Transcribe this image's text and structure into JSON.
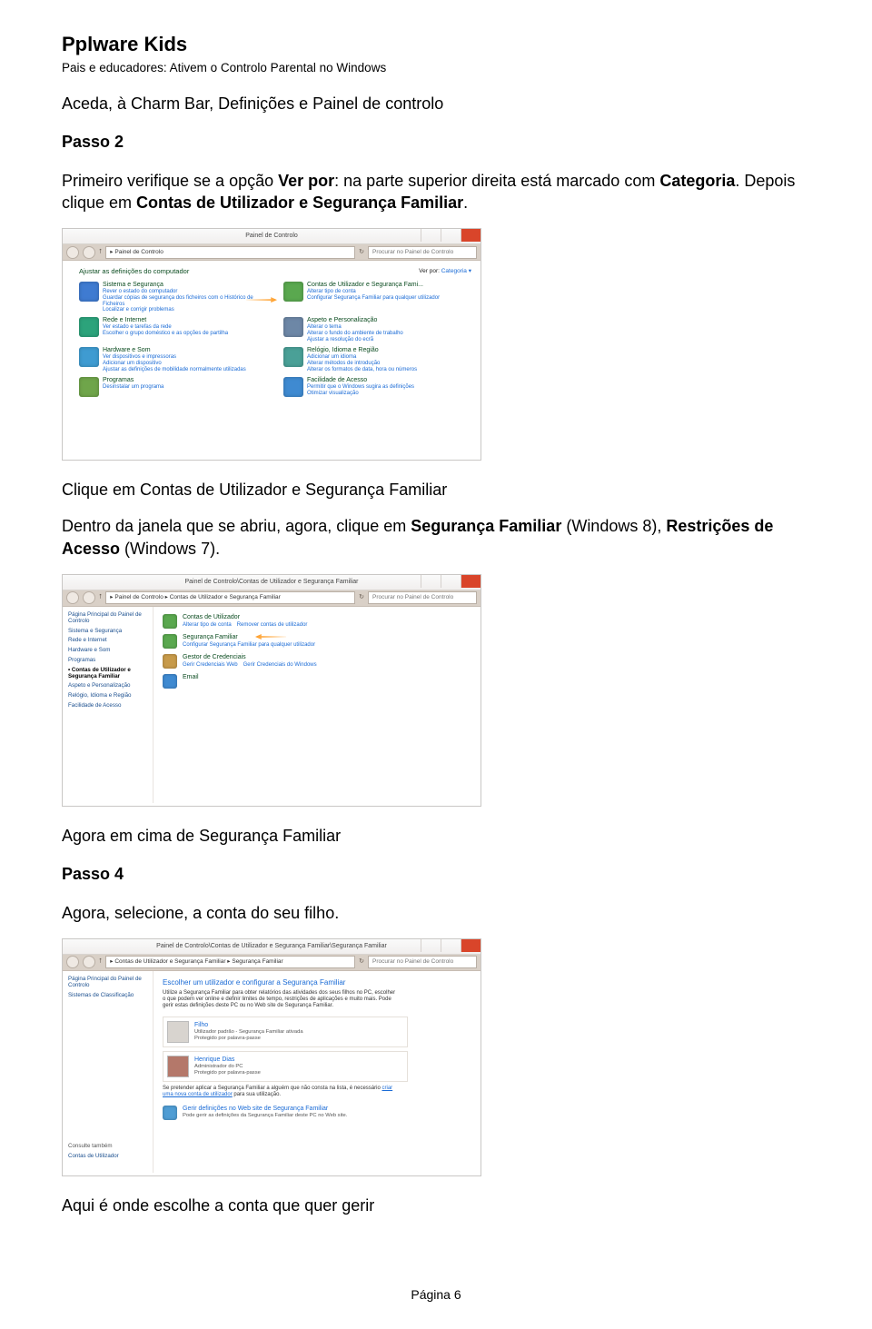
{
  "header": {
    "site_title": "Pplware Kids",
    "subtitle": "Pais e educadores: Ativem o Controlo Parental no Windows"
  },
  "intro_line": "Aceda,  à Charm Bar, Definições e Painel de controlo",
  "passo2": "Passo 2",
  "para2_a": "Primeiro verifique se a opção ",
  "para2_b": "Ver por",
  "para2_c": ": na parte superior direita está marcado com ",
  "para2_d": "Categoria",
  "para2_e": ". Depois clique em ",
  "para2_f": "Contas de Utilizador e Segurança Familiar",
  "para2_g": ".",
  "shot1": {
    "title": "Painel de Controlo",
    "breadcrumb": "▸ Painel de Controlo",
    "search_ph": "Procurar no Painel de Controlo",
    "adjust": "Ajustar as definições do computador",
    "viewby_lbl": "Ver por:",
    "viewby_val": "Categoria ▾",
    "cats_left": [
      {
        "t": "Sistema e Segurança",
        "l": [
          "Rever o estado do computador",
          "Guardar cópias de segurança dos ficheiros com o Histórico de Ficheiros",
          "Localizar e corrigir problemas"
        ],
        "c": "#3f7bd1"
      },
      {
        "t": "Rede e Internet",
        "l": [
          "Ver estado e tarefas da rede",
          "Escolher o grupo doméstico e as opções de partilha"
        ],
        "c": "#2ca37b"
      },
      {
        "t": "Hardware e Som",
        "l": [
          "Ver dispositivos e impressoras",
          "Adicionar um dispositivo",
          "Ajustar as definições de mobilidade normalmente utilizadas"
        ],
        "c": "#3f9bd1"
      },
      {
        "t": "Programas",
        "l": [
          "Desinstalar um programa"
        ],
        "c": "#6fa54a"
      }
    ],
    "cats_right": [
      {
        "t": "Contas de Utilizador e Segurança Fami...",
        "l": [
          "Alterar tipo de conta",
          "Configurar Segurança Familiar para qualquer utilizador"
        ],
        "c": "#5aa84f"
      },
      {
        "t": "Aspeto e Personalização",
        "l": [
          "Alterar o tema",
          "Alterar o fundo do ambiente de trabalho",
          "Ajustar a resolução do ecrã"
        ],
        "c": "#6d87a6"
      },
      {
        "t": "Relógio, Idioma e Região",
        "l": [
          "Adicionar um idioma",
          "Alterar métodos de introdução",
          "Alterar os formatos de data, hora ou números"
        ],
        "c": "#4aa097"
      },
      {
        "t": "Facilidade de Acesso",
        "l": [
          "Permitir que o Windows sugira as definições",
          "Otimizar visualização"
        ],
        "c": "#3f8ad1"
      }
    ]
  },
  "caption1": "Clique em Contas de Utilizador e Segurança Familiar",
  "para3_a": "Dentro da janela que se abriu, agora, clique em ",
  "para3_b": "Segurança Familiar",
  "para3_c": " (Windows 8), ",
  "para3_d": "Restrições de Acesso",
  "para3_e": " (Windows 7).",
  "shot2": {
    "title": "Painel de Controlo\\Contas de Utilizador e Segurança Familiar",
    "breadcrumb": "▸ Painel de Controlo ▸ Contas de Utilizador e Segurança Familiar",
    "search_ph": "Procurar no Painel de Controlo",
    "sidebar": [
      "Página Principal do Painel de Controlo",
      "Sistema e Segurança",
      "Rede e Internet",
      "Hardware e Som",
      "Programas",
      "Contas de Utilizador e Segurança Familiar",
      "Aspeto e Personalização",
      "Relógio, Idioma e Região",
      "Facilidade de Acesso"
    ],
    "items": [
      {
        "t": "Contas de Utilizador",
        "l": [
          "Alterar tipo de conta",
          "Remover contas de utilizador"
        ],
        "c": "#5aa84f"
      },
      {
        "t": "Segurança Familiar",
        "l": [
          "Configurar Segurança Familiar para qualquer utilizador"
        ],
        "c": "#5aa84f"
      },
      {
        "t": "Gestor de Credenciais",
        "l": [
          "Gerir Credenciais Web",
          "Gerir Credenciais do Windows"
        ],
        "c": "#c79a4a"
      },
      {
        "t": "Email",
        "l": [],
        "c": "#3f8ad1"
      }
    ]
  },
  "caption2": "Agora em cima de Segurança Familiar",
  "passo4": "Passo 4",
  "para4": "Agora, selecione, a conta do seu filho.",
  "shot3": {
    "title": "Painel de Controlo\\Contas de Utilizador e Segurança Familiar\\Segurança Familiar",
    "breadcrumb": "▸ Contas de Utilizador e Segurança Familiar ▸ Segurança Familiar",
    "search_ph": "Procurar no Painel de Controlo",
    "sidebar": [
      "Página Principal do Painel de Controlo",
      "Sistemas de Classificação"
    ],
    "heading": "Escolher um utilizador e configurar a Segurança Familiar",
    "desc": "Utilize a Segurança Familiar para obter relatórios das atividades dos seus filhos no PC, escolher o que podem ver online e definir limites de tempo, restrições de aplicações e muito mais. Pode gerir estas definições deste PC ou no Web site de Segurança Familiar.",
    "users": [
      {
        "nm": "Filho",
        "sub1": "Utilizador padrão - Segurança Familiar ativada",
        "sub2": "Protegido por palavra-passe"
      },
      {
        "nm": "Henrique Dias",
        "sub1": "Administrador do PC",
        "sub2": "Protegido por palavra-passe"
      }
    ],
    "note_a": "Se pretender aplicar a Segurança Familiar a alguém que não consta na lista, é necessário ",
    "note_link": "criar uma nova conta de utilizador",
    "note_b": " para sua utilização.",
    "web_t": "Gerir definições no Web site de Segurança Familiar",
    "web_sub": "Pode gerir as definições da Segurança Familiar deste PC no Web site.",
    "bottom1": "Consulte também",
    "bottom2": "Contas de Utilizador"
  },
  "caption3": "Aqui é onde escolhe a conta que quer gerir",
  "footer": "Página 6"
}
